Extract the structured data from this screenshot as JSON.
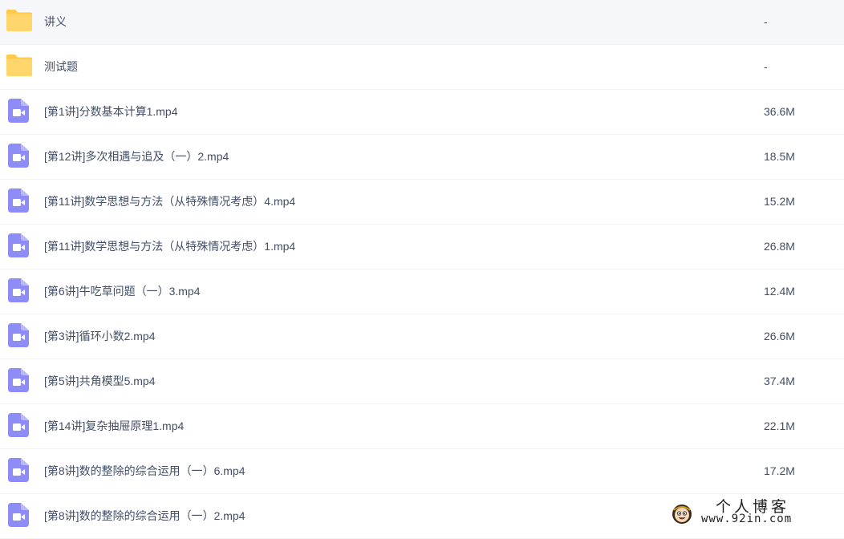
{
  "colors": {
    "folder": "#ffd66b",
    "folder_tab": "#ffc94a",
    "video": "#8e8df7",
    "text": "#424e67",
    "divider": "#f1f2f4"
  },
  "files": [
    {
      "name": "讲义",
      "size": "-",
      "icon": "folder-icon"
    },
    {
      "name": "测试题",
      "size": "-",
      "icon": "folder-icon"
    },
    {
      "name": "[第1讲]分数基本计算1.mp4",
      "size": "36.6M",
      "icon": "video-file-icon"
    },
    {
      "name": "[第12讲]多次相遇与追及（一）2.mp4",
      "size": "18.5M",
      "icon": "video-file-icon"
    },
    {
      "name": "[第11讲]数学思想与方法（从特殊情况考虑）4.mp4",
      "size": "15.2M",
      "icon": "video-file-icon"
    },
    {
      "name": "[第11讲]数学思想与方法（从特殊情况考虑）1.mp4",
      "size": "26.8M",
      "icon": "video-file-icon"
    },
    {
      "name": "[第6讲]牛吃草问题（一）3.mp4",
      "size": "12.4M",
      "icon": "video-file-icon"
    },
    {
      "name": "[第3讲]循环小数2.mp4",
      "size": "26.6M",
      "icon": "video-file-icon"
    },
    {
      "name": "[第5讲]共角模型5.mp4",
      "size": "37.4M",
      "icon": "video-file-icon"
    },
    {
      "name": "[第14讲]复杂抽屉原理1.mp4",
      "size": "22.1M",
      "icon": "video-file-icon"
    },
    {
      "name": "[第8讲]数的整除的综合运用（一）6.mp4",
      "size": "17.2M",
      "icon": "video-file-icon"
    },
    {
      "name": "[第8讲]数的整除的综合运用（一）2.mp4",
      "size": "",
      "icon": "video-file-icon"
    }
  ],
  "watermark": {
    "title": "个人博客",
    "url": "www.92in.com"
  }
}
